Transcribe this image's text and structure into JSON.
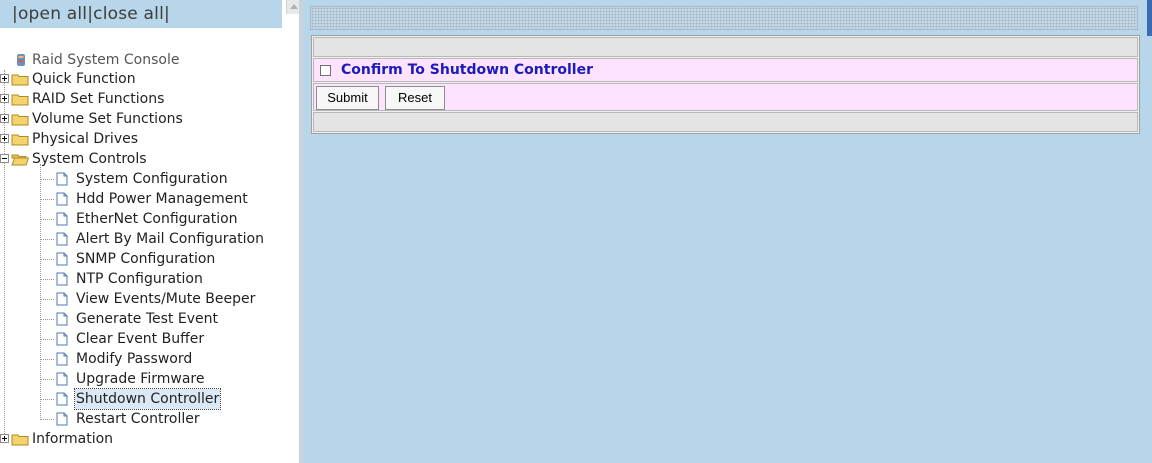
{
  "topbar": {
    "text_before": "|",
    "open_all": "open all",
    "separator": "|",
    "close_all": "close all",
    "text_after": "|"
  },
  "tree": {
    "root": {
      "label": "Raid System Console",
      "icon": "raid-console-icon"
    },
    "folders": [
      {
        "label": "Quick Function",
        "expanded": false
      },
      {
        "label": "RAID Set Functions",
        "expanded": false
      },
      {
        "label": "Volume Set Functions",
        "expanded": false
      },
      {
        "label": "Physical Drives",
        "expanded": false
      },
      {
        "label": "System Controls",
        "expanded": true
      },
      {
        "label": "Information",
        "expanded": false
      }
    ],
    "system_controls_items": [
      "System Configuration",
      "Hdd Power Management",
      "EtherNet Configuration",
      "Alert By Mail Configuration",
      "SNMP Configuration",
      "NTP Configuration",
      "View Events/Mute Beeper",
      "Generate Test Event",
      "Clear Event Buffer",
      "Modify Password",
      "Upgrade Firmware",
      "Shutdown Controller",
      "Restart Controller"
    ],
    "selected_item": "Shutdown Controller"
  },
  "form": {
    "confirm_label": "Confirm To Shutdown Controller",
    "confirm_checked": false,
    "submit_label": "Submit",
    "reset_label": "Reset"
  },
  "colors": {
    "frame_background": "#b7d6ea",
    "form_row_pink": "#fde3fd",
    "confirm_text": "#1b1bbd",
    "folder_yellow": "#f3d36b"
  }
}
